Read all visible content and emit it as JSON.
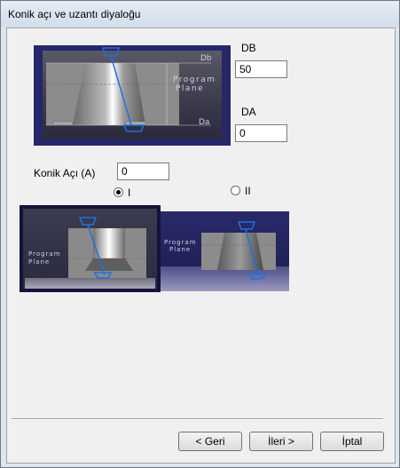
{
  "window": {
    "title": "Konik açı ve uzantı diyaloğu"
  },
  "fields": {
    "db": {
      "label": "DB",
      "value": "50"
    },
    "da": {
      "label": "DA",
      "value": "0"
    },
    "konik": {
      "label": "Konik Açı (A)",
      "value": "0"
    }
  },
  "radios": {
    "option1": {
      "label": "I",
      "checked": true
    },
    "option2": {
      "label": "II",
      "checked": false
    }
  },
  "diagram_main": {
    "db_text": "Db",
    "da_text": "Da",
    "plane_line1": "Program",
    "plane_line2": "Plane"
  },
  "diagram_i": {
    "plane_line1": "Program",
    "plane_line2": "Plane"
  },
  "diagram_ii": {
    "plane_line1": "Program",
    "plane_line2": "Plane"
  },
  "buttons": {
    "back": "< Geri",
    "next": "İleri >",
    "cancel": "İptal"
  },
  "colors": {
    "accent_tool": "#1f6fe0",
    "background_dark": "#26266a"
  }
}
